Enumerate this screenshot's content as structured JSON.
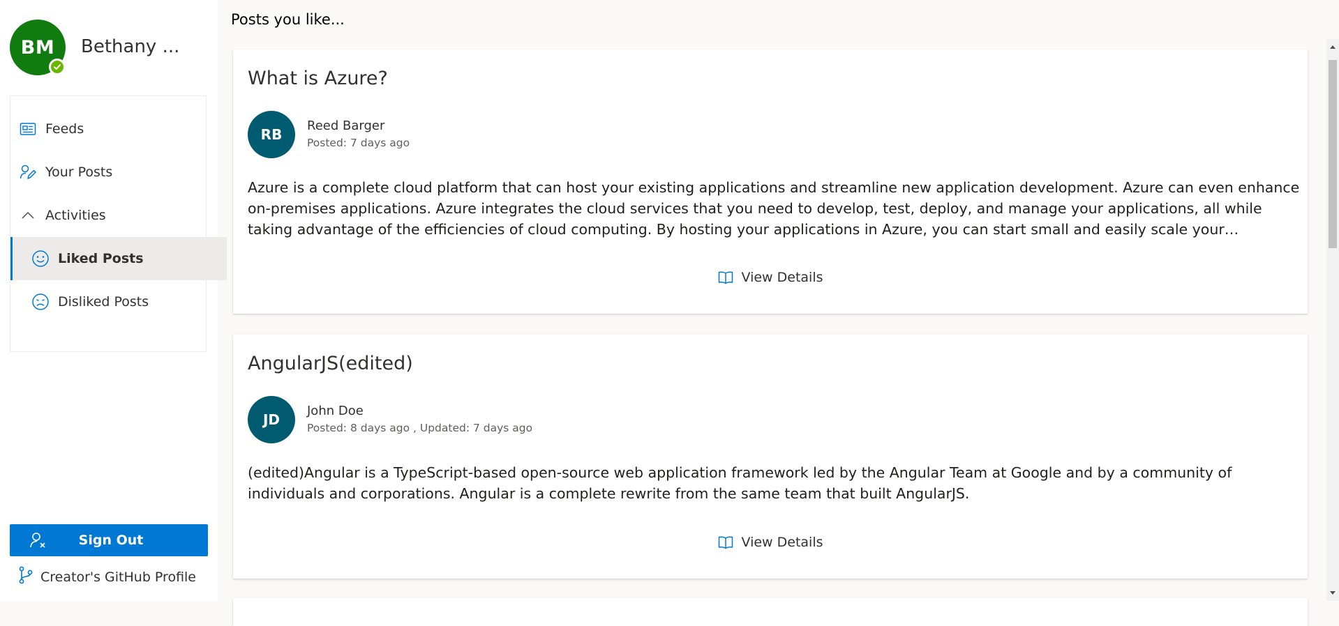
{
  "profile": {
    "initials": "BM",
    "name": "Bethany ...",
    "presence": "available"
  },
  "nav": {
    "feeds": "Feeds",
    "your_posts": "Your Posts",
    "activities": "Activities",
    "liked_posts": "Liked Posts",
    "disliked_posts": "Disliked Posts",
    "selected": "Liked Posts"
  },
  "footer": {
    "sign_out": "Sign Out",
    "github": "Creator's GitHub Profile"
  },
  "main": {
    "title": "Posts you like...",
    "posts": [
      {
        "title": "What is Azure?",
        "author_initials": "RB",
        "author": "Reed Barger",
        "meta": "Posted: 7 days ago",
        "body": "Azure is a complete cloud platform that can host your existing applications and streamline new application development. Azure can even enhance on-premises applications. Azure integrates the cloud services that you need to develop, test, deploy, and manage your applications, all while taking advantage of the efficiencies of cloud computing. By hosting your applications in Azure, you can start small and easily scale your application as your...",
        "action": "View Details"
      },
      {
        "title": "AngularJS(edited)",
        "author_initials": "JD",
        "author": "John Doe",
        "meta": "Posted: 8 days ago , Updated: 7 days ago",
        "body": "(edited)Angular is a TypeScript-based open-source web application framework led by the Angular Team at Google and by a community of individuals and corporations. Angular is a complete rewrite from the same team that built AngularJS.",
        "action": "View Details"
      }
    ]
  },
  "colors": {
    "accent": "#0078d4",
    "profile_avatar": "#107c10",
    "author_avatar": "#005b70",
    "presence": "#6bb700"
  },
  "icons": {
    "feeds": "news-icon",
    "your_posts": "edit-person-icon",
    "activities": "chevron-up-icon",
    "liked": "smiley-icon",
    "disliked": "sad-icon",
    "sign_out": "remove-person-icon",
    "github": "branch-icon",
    "view_details": "book-icon"
  }
}
